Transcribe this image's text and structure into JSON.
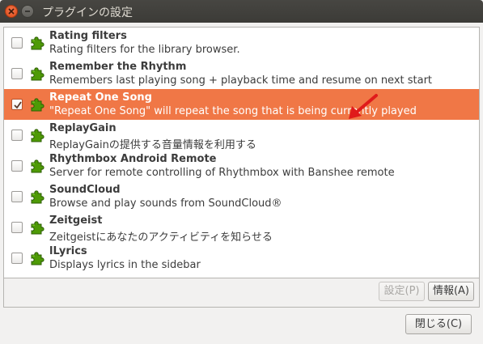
{
  "window": {
    "title": "プラグインの設定"
  },
  "plugins": [
    {
      "name": "Rating filters",
      "description": "Rating filters for the library browser.",
      "checked": false,
      "selected": false
    },
    {
      "name": "Remember the Rhythm",
      "description": "Remembers last playing song + playback time and resume on next start",
      "checked": false,
      "selected": false
    },
    {
      "name": "Repeat One Song",
      "description": "\"Repeat One Song\" will repeat the song that is being currently played",
      "checked": true,
      "selected": true
    },
    {
      "name": "ReplayGain",
      "description": "ReplayGainの提供する音量情報を利用する",
      "checked": false,
      "selected": false
    },
    {
      "name": "Rhythmbox Android Remote",
      "description": "Server for remote controlling of Rhythmbox with Banshee remote",
      "checked": false,
      "selected": false
    },
    {
      "name": "SoundCloud",
      "description": "Browse and play sounds from SoundCloud®",
      "checked": false,
      "selected": false
    },
    {
      "name": "Zeitgeist",
      "description": "Zeitgeistにあなたのアクティビティを知らせる",
      "checked": false,
      "selected": false
    },
    {
      "name": "lLyrics",
      "description": "Displays lyrics in the sidebar",
      "checked": false,
      "selected": false
    }
  ],
  "cutoff_text": "・・・・・・・",
  "buttons": {
    "settings": "設定(P)",
    "info": "情報(A)",
    "close": "閉じる(C)"
  },
  "colors": {
    "selection": "#f07746",
    "plugin_icon": "#4e9a06",
    "arrow": "#e01b1b"
  }
}
